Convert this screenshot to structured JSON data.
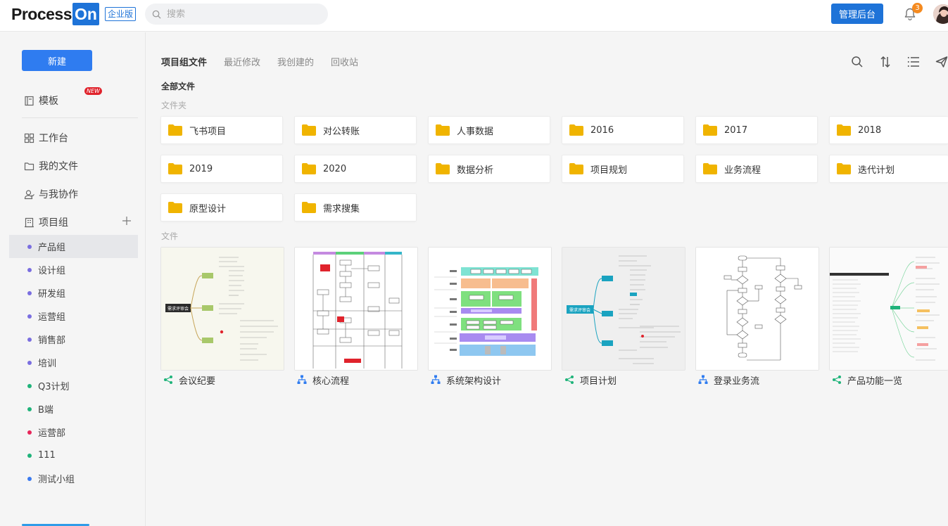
{
  "header": {
    "logo_text": "Process",
    "logo_on": "On",
    "edition": "企业版",
    "search_placeholder": "搜索",
    "admin_button": "管理后台",
    "notification_count": "3"
  },
  "sidebar": {
    "new_button": "新建",
    "nav": [
      {
        "label": "模板",
        "icon": "template-icon",
        "badge": "NEW"
      },
      {
        "label": "工作台",
        "icon": "dashboard-icon"
      },
      {
        "label": "我的文件",
        "icon": "folder-icon"
      },
      {
        "label": "与我协作",
        "icon": "collaborate-icon"
      },
      {
        "label": "项目组",
        "icon": "building-icon"
      }
    ],
    "groups": [
      {
        "label": "产品组",
        "color": "#7a6ee0",
        "active": true
      },
      {
        "label": "设计组",
        "color": "#7a6ee0"
      },
      {
        "label": "研发组",
        "color": "#7a6ee0"
      },
      {
        "label": "运营组",
        "color": "#7a6ee0"
      },
      {
        "label": "销售部",
        "color": "#7a6ee0"
      },
      {
        "label": "培训",
        "color": "#7a6ee0"
      },
      {
        "label": "Q3计划",
        "color": "#1fb37a"
      },
      {
        "label": "B端",
        "color": "#1fb37a"
      },
      {
        "label": "运营部",
        "color": "#e8265a"
      },
      {
        "label": "111",
        "color": "#1fb37a"
      },
      {
        "label": "测试小组",
        "color": "#3a7af0"
      }
    ]
  },
  "main": {
    "tabs": [
      {
        "label": "项目组文件",
        "active": true
      },
      {
        "label": "最近修改"
      },
      {
        "label": "我创建的"
      },
      {
        "label": "回收站"
      }
    ],
    "breadcrumb": "全部文件",
    "folders_label": "文件夹",
    "folders": [
      "飞书项目",
      "对公转账",
      "人事数据",
      "2016",
      "2017",
      "2018",
      "2019",
      "2020",
      "数据分析",
      "项目规划",
      "业务流程",
      "迭代计划",
      "原型设计",
      "需求搜集"
    ],
    "files_label": "文件",
    "files": [
      {
        "name": "会议纪要",
        "type": "mindmap"
      },
      {
        "name": "核心流程",
        "type": "flowchart"
      },
      {
        "name": "系统架构设计",
        "type": "flowchart"
      },
      {
        "name": "项目计划",
        "type": "mindmap"
      },
      {
        "name": "登录业务流",
        "type": "flowchart"
      },
      {
        "name": "产品功能一览",
        "type": "mindmap"
      }
    ],
    "thumb_labels": {
      "meeting_root": "需求评审会",
      "plan_root": "需求评审会"
    }
  },
  "colors": {
    "accent": "#1e73d8",
    "folder": "#f0b400",
    "mindmap_icon": "#1fb37a",
    "flow_icon": "#2f7cf0"
  }
}
